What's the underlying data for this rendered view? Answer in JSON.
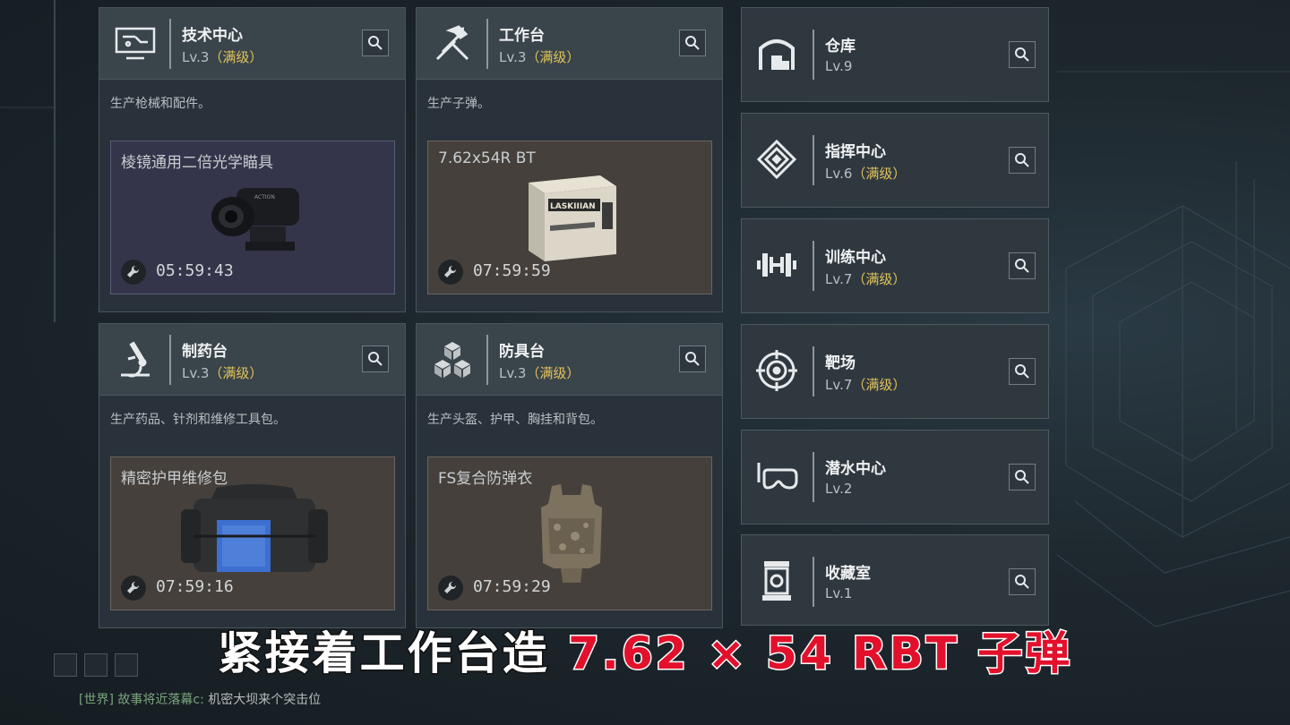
{
  "workshops": [
    {
      "name": "技术中心",
      "level": "Lv.3",
      "max_tag": "（满级）",
      "description": "生产枪械和配件。",
      "item_name": "棱镜通用二倍光学瞄具",
      "timer": "05:59:43",
      "icon": "monitor-icon"
    },
    {
      "name": "工作台",
      "level": "Lv.3",
      "max_tag": "（满级）",
      "description": "生产子弹。",
      "item_name": "7.62x54R BT",
      "item_art_text": "LASKIIIAN",
      "timer": "07:59:59",
      "icon": "tools-icon"
    },
    {
      "name": "制药台",
      "level": "Lv.3",
      "max_tag": "（满级）",
      "description": "生产药品、针剂和维修工具包。",
      "item_name": "精密护甲维修包",
      "timer": "07:59:16",
      "icon": "microscope-icon"
    },
    {
      "name": "防具台",
      "level": "Lv.3",
      "max_tag": "（满级）",
      "description": "生产头盔、护甲、胸挂和背包。",
      "item_name": "FS复合防弹衣",
      "timer": "07:59:29",
      "icon": "cubes-icon"
    }
  ],
  "facilities": [
    {
      "name": "仓库",
      "level": "Lv.9",
      "max_tag": "",
      "icon": "warehouse-icon"
    },
    {
      "name": "指挥中心",
      "level": "Lv.6",
      "max_tag": "（满级）",
      "icon": "command-icon"
    },
    {
      "name": "训练中心",
      "level": "Lv.7",
      "max_tag": "（满级）",
      "icon": "dumbbell-icon"
    },
    {
      "name": "靶场",
      "level": "Lv.7",
      "max_tag": "（满级）",
      "icon": "target-icon"
    },
    {
      "name": "潜水中心",
      "level": "Lv.2",
      "max_tag": "",
      "icon": "diving-mask-icon"
    },
    {
      "name": "收藏室",
      "level": "Lv.1",
      "max_tag": "",
      "icon": "showcase-icon"
    }
  ],
  "caption": {
    "white_part": "紧接着工作台造",
    "red_part": "7.62 × 54 RBT 子弹"
  },
  "chat": {
    "channel": "[世界]",
    "user": "故事将近落幕c:",
    "message": "机密大坝来个突击位"
  },
  "colors": {
    "max_level": "#e1c35a",
    "caption_red": "#e3102c"
  }
}
